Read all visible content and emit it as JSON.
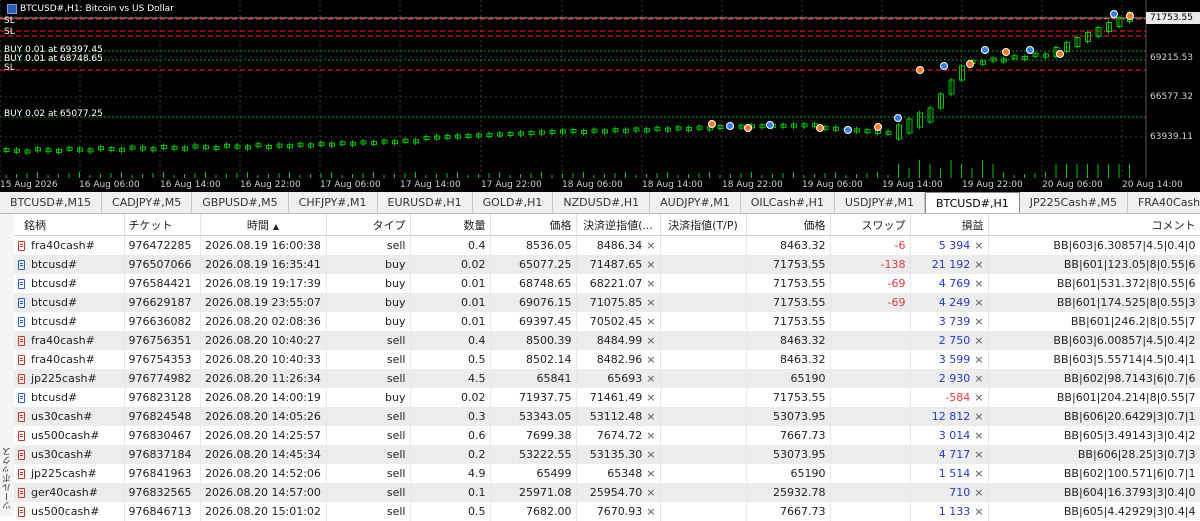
{
  "chart": {
    "title": "BTCUSD#,H1:  Bitcoin vs US Dollar",
    "current_price": "71753.55",
    "price_labels": [
      "69215.53",
      "66577.32",
      "63939.11"
    ],
    "time_labels": [
      "15 Aug 2026",
      "16 Aug 06:00",
      "16 Aug 14:00",
      "16 Aug 22:00",
      "17 Aug 06:00",
      "17 Aug 14:00",
      "17 Aug 22:00",
      "18 Aug 06:00",
      "18 Aug 14:00",
      "18 Aug 22:00",
      "19 Aug 06:00",
      "19 Aug 14:00",
      "19 Aug 22:00",
      "20 Aug 06:00",
      "20 Aug 14:00"
    ],
    "line_labels": {
      "sl1": "SL",
      "sl2": "SL",
      "buy1": "BUY 0.01 at 69397.45",
      "buy2": "BUY 0.01 at 68748.65",
      "sl3": "SL",
      "buy3": "BUY 0.02 at 65077.25"
    },
    "colors": {
      "background": "#000000",
      "candle_up": "#00c000",
      "sl_line": "#ff2020",
      "entry_line": "#00a000",
      "current_line": "#8a8a8a"
    }
  },
  "tabs": [
    "BTCUSD#,M15",
    "CADJPY#,M5",
    "GBPUSD#,M5",
    "CHFJPY#,M1",
    "EURUSD#,H1",
    "GOLD#,H1",
    "NZDUSD#,H1",
    "AUDJPY#,M1",
    "OILCash#,H1",
    "USDJPY#,M1",
    "BTCUSD#,H1",
    "JP225Cash#,M5",
    "FRA40Cash#,H1"
  ],
  "active_tab": "BTCUSD#,H1",
  "toolbox_label": "ツールボックス",
  "table": {
    "headers": [
      "銘柄",
      "チケット",
      "時間",
      "タイプ",
      "数量",
      "価格",
      "決済逆指値(...",
      "決済指値(T/P)",
      "価格",
      "スワップ",
      "損益",
      "コメント"
    ],
    "sort_icon": "▲",
    "close_glyph": "×",
    "rows": [
      {
        "symbol": "fra40cash#",
        "ticket": "976472285",
        "time": "2026.08.19 16:00:38",
        "type": "sell",
        "volume": "0.4",
        "price": "8536.05",
        "sl": "8486.34",
        "tp": "",
        "cur_price": "8463.32",
        "swap": "-6",
        "profit": "5 394",
        "comment": "BB|603|6.30857|4.5|0.4|0"
      },
      {
        "symbol": "btcusd#",
        "ticket": "976507066",
        "time": "2026.08.19 16:35:41",
        "type": "buy",
        "volume": "0.02",
        "price": "65077.25",
        "sl": "71487.65",
        "tp": "",
        "cur_price": "71753.55",
        "swap": "-138",
        "profit": "21 192",
        "comment": "BB|601|123.05|8|0.55|6"
      },
      {
        "symbol": "btcusd#",
        "ticket": "976584421",
        "time": "2026.08.19 19:17:39",
        "type": "buy",
        "volume": "0.01",
        "price": "68748.65",
        "sl": "68221.07",
        "tp": "",
        "cur_price": "71753.55",
        "swap": "-69",
        "profit": "4 769",
        "comment": "BB|601|531.372|8|0.55|6"
      },
      {
        "symbol": "btcusd#",
        "ticket": "976629187",
        "time": "2026.08.19 23:55:07",
        "type": "buy",
        "volume": "0.01",
        "price": "69076.15",
        "sl": "71075.85",
        "tp": "",
        "cur_price": "71753.55",
        "swap": "-69",
        "profit": "4 249",
        "comment": "BB|601|174.525|8|0.55|3"
      },
      {
        "symbol": "btcusd#",
        "ticket": "976636082",
        "time": "2026.08.20 02:08:36",
        "type": "buy",
        "volume": "0.01",
        "price": "69397.45",
        "sl": "70502.45",
        "tp": "",
        "cur_price": "71753.55",
        "swap": "",
        "profit": "3 739",
        "comment": "BB|601|246.2|8|0.55|7"
      },
      {
        "symbol": "fra40cash#",
        "ticket": "976756351",
        "time": "2026.08.20 10:40:27",
        "type": "sell",
        "volume": "0.4",
        "price": "8500.39",
        "sl": "8484.99",
        "tp": "",
        "cur_price": "8463.32",
        "swap": "",
        "profit": "2 750",
        "comment": "BB|603|6.00857|4.5|0.4|2"
      },
      {
        "symbol": "fra40cash#",
        "ticket": "976754353",
        "time": "2026.08.20 10:40:33",
        "type": "sell",
        "volume": "0.5",
        "price": "8502.14",
        "sl": "8482.96",
        "tp": "",
        "cur_price": "8463.32",
        "swap": "",
        "profit": "3 599",
        "comment": "BB|603|5.55714|4.5|0.4|1"
      },
      {
        "symbol": "jp225cash#",
        "ticket": "976774982",
        "time": "2026.08.20 11:26:34",
        "type": "sell",
        "volume": "4.5",
        "price": "65841",
        "sl": "65693",
        "tp": "",
        "cur_price": "65190",
        "swap": "",
        "profit": "2 930",
        "comment": "BB|602|98.7143|6|0.7|6"
      },
      {
        "symbol": "btcusd#",
        "ticket": "976823128",
        "time": "2026.08.20 14:00:19",
        "type": "buy",
        "volume": "0.02",
        "price": "71937.75",
        "sl": "71461.49",
        "tp": "",
        "cur_price": "71753.55",
        "swap": "",
        "profit": "-584",
        "comment": "BB|601|204.214|8|0.55|7"
      },
      {
        "symbol": "us30cash#",
        "ticket": "976824548",
        "time": "2026.08.20 14:05:26",
        "type": "sell",
        "volume": "0.3",
        "price": "53343.05",
        "sl": "53112.48",
        "tp": "",
        "cur_price": "53073.95",
        "swap": "",
        "profit": "12 812",
        "comment": "BB|606|20.6429|3|0.7|1"
      },
      {
        "symbol": "us500cash#",
        "ticket": "976830467",
        "time": "2026.08.20 14:25:57",
        "type": "sell",
        "volume": "0.6",
        "price": "7699.38",
        "sl": "7674.72",
        "tp": "",
        "cur_price": "7667.73",
        "swap": "",
        "profit": "3 014",
        "comment": "BB|605|3.49143|3|0.4|2"
      },
      {
        "symbol": "us30cash#",
        "ticket": "976837184",
        "time": "2026.08.20 14:45:34",
        "type": "sell",
        "volume": "0.2",
        "price": "53222.55",
        "sl": "53135.30",
        "tp": "",
        "cur_price": "53073.95",
        "swap": "",
        "profit": "4 717",
        "comment": "BB|606|28.25|3|0.7|3"
      },
      {
        "symbol": "jp225cash#",
        "ticket": "976841963",
        "time": "2026.08.20 14:52:06",
        "type": "sell",
        "volume": "4.9",
        "price": "65499",
        "sl": "65348",
        "tp": "",
        "cur_price": "65190",
        "swap": "",
        "profit": "1 514",
        "comment": "BB|602|100.571|6|0.7|1"
      },
      {
        "symbol": "ger40cash#",
        "ticket": "976832565",
        "time": "2026.08.20 14:57:00",
        "type": "sell",
        "volume": "0.1",
        "price": "25971.08",
        "sl": "25954.70",
        "tp": "",
        "cur_price": "25932.78",
        "swap": "",
        "profit": "710",
        "comment": "BB|604|16.3793|3|0.4|0"
      },
      {
        "symbol": "us500cash#",
        "ticket": "976846713",
        "time": "2026.08.20 15:01:02",
        "type": "sell",
        "volume": "0.5",
        "price": "7682.00",
        "sl": "7670.93",
        "tp": "",
        "cur_price": "7667.73",
        "swap": "",
        "profit": "1 133",
        "comment": "BB|605|4.42929|3|0.4|4"
      }
    ]
  }
}
